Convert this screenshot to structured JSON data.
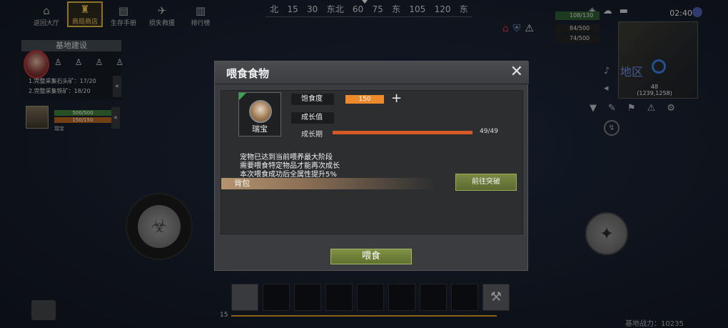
{
  "top_menu": [
    {
      "label": "返回大厅",
      "icon": "home-icon",
      "glyph": "⌂",
      "active": false
    },
    {
      "label": "商局商店",
      "icon": "shop-icon",
      "glyph": "♜",
      "active": true
    },
    {
      "label": "生存手册",
      "icon": "book-icon",
      "glyph": "▤",
      "active": false
    },
    {
      "label": "损失救援",
      "icon": "rescue-icon",
      "glyph": "✈",
      "active": false
    },
    {
      "label": "排行榜",
      "icon": "ranking-icon",
      "glyph": "▥",
      "active": false
    }
  ],
  "compass": {
    "marks": [
      "北",
      "15",
      "30",
      "东北",
      "60",
      "75",
      "东",
      "105",
      "120",
      "东"
    ]
  },
  "base_panel": {
    "title": "基地建设",
    "tasks": [
      "1.完整采集石头矿：17/20",
      "2.完整采集铁矿：18/20"
    ]
  },
  "pet_status": {
    "health_text": "500/500",
    "hunger_text": "150/150",
    "label": "瑞宝"
  },
  "hud": {
    "time": "02:40",
    "health": "108/130",
    "food": "84/500",
    "water": "74/500",
    "minimap_level": "48",
    "minimap_coords": "(1239,1258)",
    "minimap_region": "地区"
  },
  "dialog": {
    "title": "喂食食物",
    "close_glyph": "✕",
    "pet_name": "瑞宝",
    "satiety_label": "饱食度",
    "satiety_value": "150",
    "plus_glyph": "+",
    "growth_label": "成长值",
    "growth_stage_label": "成长期",
    "growth_value": "49/49",
    "growth_fraction": 1.0,
    "info_lines": [
      "宠物已达到当前喂养最大阶段",
      "需要喂食特定物品才能再次成长",
      "本次喂食成功后全属性提升5%"
    ],
    "backpack_label": "背包",
    "breakthrough_button": "前往突破",
    "feed_button": "喂食"
  },
  "hotbar": {
    "number": "15",
    "slots": 8
  },
  "base_power": "基地战力：10235",
  "colors": {
    "accent_orange": "#ed8a2c",
    "growth_fill": "#d45a28",
    "button_green": "#6f8038",
    "hotbar_line": "#d8951e"
  }
}
